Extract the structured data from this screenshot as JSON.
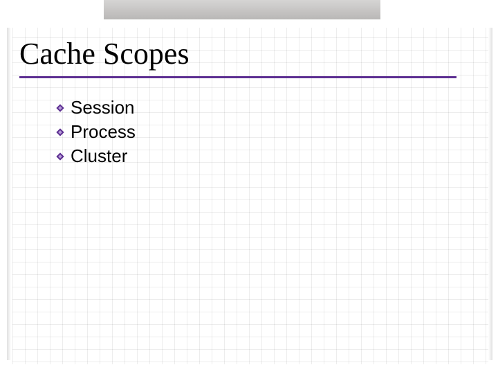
{
  "colors": {
    "accent": "#5c2e91",
    "text": "#111111",
    "grid": "rgba(0,0,0,0.07)",
    "top_bar": "#c2c0bf"
  },
  "title": "Cache Scopes",
  "bullets": [
    {
      "label": "Session"
    },
    {
      "label": "Process"
    },
    {
      "label": "Cluster"
    }
  ]
}
